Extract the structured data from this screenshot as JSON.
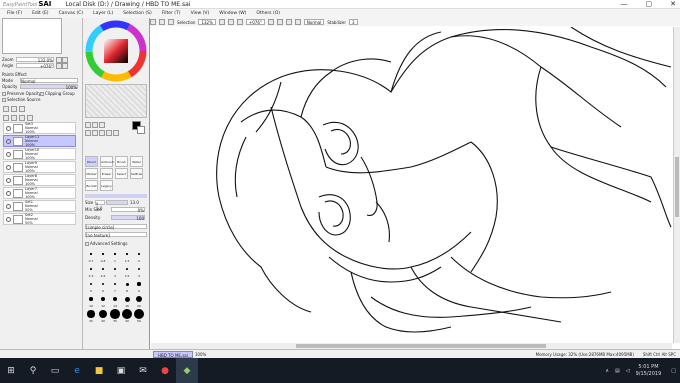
{
  "app": {
    "brand_small": "EasyPaintTool",
    "brand": "SAI",
    "title": "Local Disk (D:) / Drawing / HBD TO ME.sai"
  },
  "window_controls": [
    "—",
    "▢",
    "✕"
  ],
  "menu": [
    "File (F)",
    "Edit (E)",
    "Canvas (C)",
    "Layer (L)",
    "Selection (S)",
    "Filter (T)",
    "View (V)",
    "Window (W)",
    "Others (O)"
  ],
  "toolbar": {
    "selection_label": "Selection",
    "zoom": "132%",
    "angle": "+076°",
    "blend": "Normal",
    "stabilizer_label": "Stabilizer",
    "stabilizer": "3"
  },
  "navigator": {
    "zoom_label": "Zoom",
    "zoom": "132.0%",
    "angle_label": "Angle",
    "angle": "+076°"
  },
  "layer_props": {
    "effects": "Paints Effect",
    "mode_label": "Mode",
    "mode": "Normal",
    "opacity_label": "Opacity",
    "opacity": "100%",
    "preserve": "Preserve Opacity",
    "clipping": "Clipping Group",
    "selection_source": "Selection Source"
  },
  "layers": [
    {
      "name": "Set3",
      "mode": "Normal",
      "opacity": "100%",
      "selected": false
    },
    {
      "name": "Layer11",
      "mode": "Normal",
      "opacity": "100%",
      "selected": true
    },
    {
      "name": "Layer10",
      "mode": "Normal",
      "opacity": "100%",
      "selected": false
    },
    {
      "name": "Layer9",
      "mode": "Normal",
      "opacity": "100%",
      "selected": false
    },
    {
      "name": "Layer8",
      "mode": "Normal",
      "opacity": "100%",
      "selected": false
    },
    {
      "name": "Layer7",
      "mode": "Normal",
      "opacity": "100%",
      "selected": false
    },
    {
      "name": "Set1",
      "mode": "Normal",
      "opacity": "50%",
      "selected": false
    },
    {
      "name": "Set2",
      "mode": "Normal",
      "opacity": "50%",
      "selected": false
    }
  ],
  "tools": [
    "Pencil",
    "Airbrush",
    "Brush",
    "Water",
    "Marker",
    "Eraser",
    "Select",
    "SelEras",
    "Bucket",
    "Legacy Pen"
  ],
  "brush": {
    "size_label": "Size",
    "size_mult": "x 1.0",
    "size": "13.0",
    "min_size_label": "Min Size",
    "min_size": "0%",
    "density_label": "Density",
    "density": "100",
    "shape": "[simple circle]",
    "texture": "[no texture]",
    "advanced": "Advanced Settings"
  },
  "brush_sizes": [
    "0.7",
    "0.8",
    "1",
    "1.5",
    "2",
    "2.3",
    "2.6",
    "3",
    "3.5",
    "4",
    "5",
    "6",
    "7",
    "8",
    "9",
    "10",
    "12",
    "14",
    "16",
    "20",
    "25",
    "30",
    "35",
    "40",
    "50"
  ],
  "status": {
    "doc_tab": "HBD TO ME.sai",
    "doc_zoom": "100%",
    "memory": "Memory Usage: 32% (Use:2876MB Max:4095MB)",
    "keys": "Shift Ctrl Alt SPC"
  },
  "taskbar": {
    "time": "5:01 PM",
    "date": "9/15/2019"
  }
}
